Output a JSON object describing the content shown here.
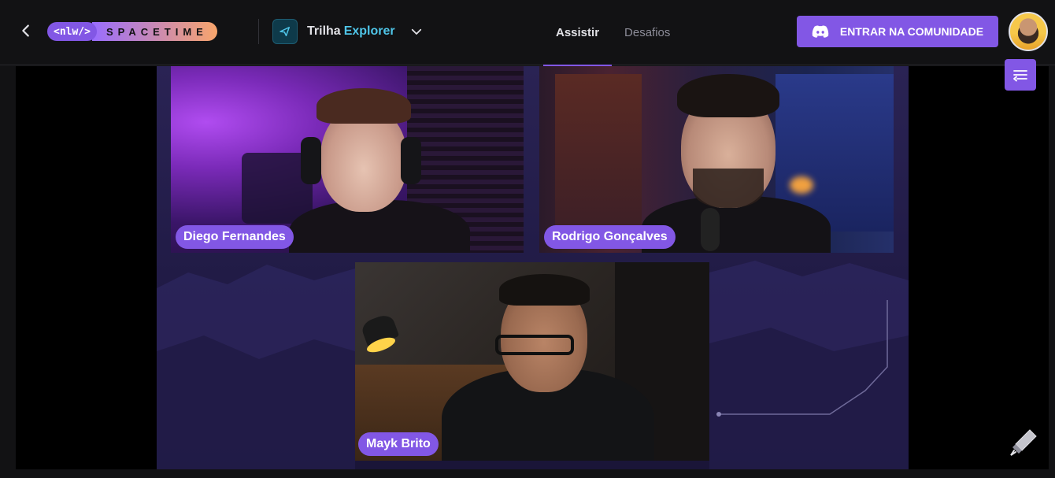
{
  "header": {
    "back_label": "Voltar",
    "logo": {
      "nlw": "<nlw/>",
      "brand": "SPACETIME"
    },
    "track": {
      "prefix": "Trilha",
      "name": "Explorer"
    },
    "nav": [
      {
        "label": "Assistir",
        "active": true
      },
      {
        "label": "Desafios",
        "active": false
      }
    ],
    "cta_label": "ENTRAR NA COMUNIDADE",
    "accent_color": "#8257e5"
  },
  "video": {
    "participants": [
      {
        "name": "Diego Fernandes"
      },
      {
        "name": "Rodrigo Gonçalves"
      },
      {
        "name": "Mayk Brito"
      }
    ]
  }
}
